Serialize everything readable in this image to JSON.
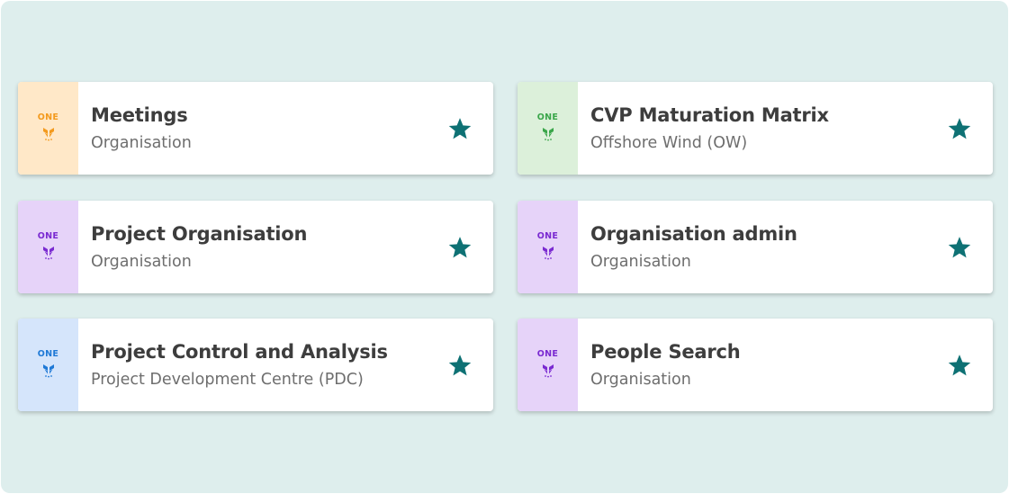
{
  "apps": [
    {
      "title": "Meetings",
      "subtitle": "Organisation",
      "badge": "ONE",
      "tint": "#ffe8c8",
      "accent": "#f39a1e",
      "name": "meetings"
    },
    {
      "title": "CVP Maturation Matrix",
      "subtitle": "Offshore Wind (OW)",
      "badge": "ONE",
      "tint": "#dcf0da",
      "accent": "#3aa64a",
      "name": "cvp-maturation-matrix"
    },
    {
      "title": "Project Organisation",
      "subtitle": "Organisation",
      "badge": "ONE",
      "tint": "#e6d3f9",
      "accent": "#7a2ad1",
      "name": "project-organisation"
    },
    {
      "title": "Organisation admin",
      "subtitle": "Organisation",
      "badge": "ONE",
      "tint": "#e6d3f9",
      "accent": "#7a2ad1",
      "name": "organisation-admin"
    },
    {
      "title": "Project Control and Analysis",
      "subtitle": "Project Development Centre (PDC)",
      "badge": "ONE",
      "tint": "#d5e5fb",
      "accent": "#1f79d6",
      "name": "project-control-and-analysis"
    },
    {
      "title": "People Search",
      "subtitle": "Organisation",
      "badge": "ONE",
      "tint": "#e6d3f9",
      "accent": "#7a2ad1",
      "name": "people-search"
    }
  ],
  "star_color": "#0e7174",
  "star_icon": "star-filled"
}
